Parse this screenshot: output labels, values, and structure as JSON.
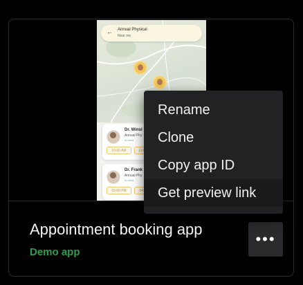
{
  "card": {
    "title": "Appointment booking app",
    "subtitle": "Demo app",
    "more_label": "•••"
  },
  "thumbnail": {
    "search_query": "Annual Physical",
    "search_sub": "Near me",
    "back_glyph": "←",
    "doctors": [
      {
        "name": "Dr. Winsl",
        "specialty": "Annual Phy",
        "insurance": "In-netw",
        "slot1": "10:00 AM",
        "slot2": "11:0"
      },
      {
        "name": "Dr. Frank",
        "specialty": "Annual Phy",
        "insurance": "In-netw",
        "slot1": "03:00 PM",
        "slot2": "04:"
      }
    ]
  },
  "menu": {
    "items": [
      {
        "label": "Rename"
      },
      {
        "label": "Clone"
      },
      {
        "label": "Copy app ID"
      },
      {
        "label": "Get preview link"
      }
    ]
  },
  "colors": {
    "background": "#000000",
    "menu_bg": "#222224",
    "accent_green": "#2f9e4f",
    "thumbnail_accent": "#f3c65a"
  }
}
